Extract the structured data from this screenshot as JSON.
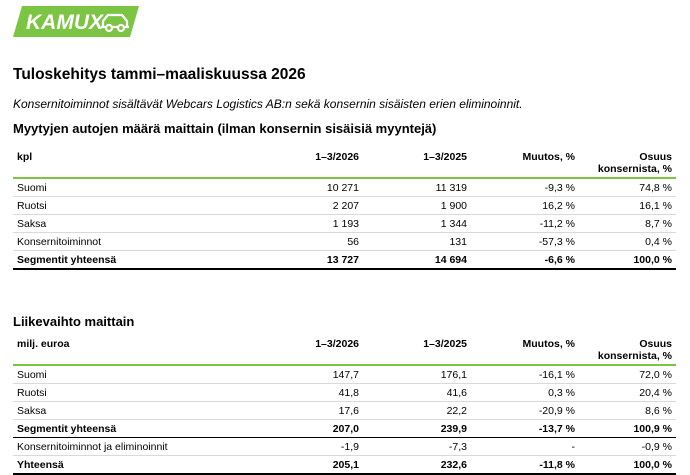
{
  "logo": {
    "text": "KAMUX"
  },
  "title": "Tuloskehitys tammi–maaliskuussa 2026",
  "intro": "Konsernitoiminnot sisältävät Webcars Logistics AB:n sekä konsernin sisäisten erien eliminoinnit.",
  "sales": {
    "heading": "Myytyjen autojen määrä maittain (ilman konsernin sisäisiä myyntejä)",
    "headers": [
      "kpl",
      "1–3/2026",
      "1–3/2025",
      "Muutos, %",
      "Osuus konsernista, %"
    ],
    "rows": [
      [
        "Suomi",
        "10 271",
        "11 319",
        "-9,3 %",
        "74,8 %"
      ],
      [
        "Ruotsi",
        "2 207",
        "1 900",
        "16,2 %",
        "16,1 %"
      ],
      [
        "Saksa",
        "1 193",
        "1 344",
        "-11,2 %",
        "8,7 %"
      ],
      [
        "Konsernitoiminnot",
        "56",
        "131",
        "-57,3 %",
        "0,4 %"
      ]
    ],
    "total": [
      "Segmentit yhteensä",
      "13 727",
      "14 694",
      "-6,6 %",
      "100,0 %"
    ]
  },
  "revenue": {
    "heading": "Liikevaihto maittain",
    "headers": [
      "milj. euroa",
      "1–3/2026",
      "1–3/2025",
      "Muutos, %",
      "Osuus konsernista, %"
    ],
    "rows": [
      [
        "Suomi",
        "147,7",
        "176,1",
        "-16,1 %",
        "72,0 %"
      ],
      [
        "Ruotsi",
        "41,8",
        "41,6",
        "0,3 %",
        "20,4 %"
      ],
      [
        "Saksa",
        "17,6",
        "22,2",
        "-20,9 %",
        "8,6 %"
      ]
    ],
    "subtotal": [
      "Segmentit yhteensä",
      "207,0",
      "239,9",
      "-13,7 %",
      "100,9 %"
    ],
    "other": [
      "Konsernitoiminnot ja eliminoinnit",
      "-1,9",
      "-7,3",
      "-",
      "-0,9 %"
    ],
    "total": [
      "Yhteensä",
      "205,1",
      "232,6",
      "-11,8 %",
      "100,0 %"
    ]
  },
  "colors": {
    "brand_green": "#7cc443",
    "rule_grey": "#d9d9d9"
  }
}
